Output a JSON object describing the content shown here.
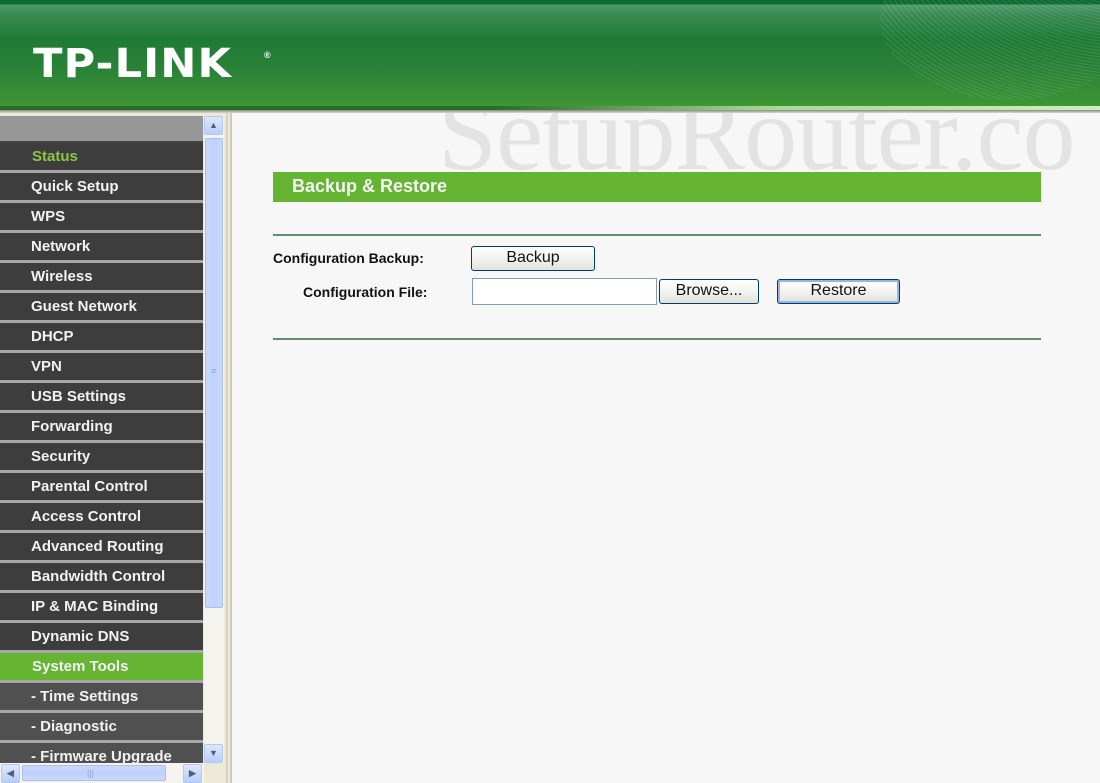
{
  "header": {
    "logo": "TP-LINK",
    "logo_mark": "®",
    "colors": {
      "header_green": "#1f7a37",
      "accent_green": "#66b532",
      "menu_dark": "#3d3d3d",
      "status_green": "#8dc63f"
    }
  },
  "watermark": "SetupRouter.co",
  "sidebar": {
    "items": [
      {
        "label": "Status",
        "state": "highlight"
      },
      {
        "label": "Quick Setup"
      },
      {
        "label": "WPS"
      },
      {
        "label": "Network"
      },
      {
        "label": "Wireless"
      },
      {
        "label": "Guest Network"
      },
      {
        "label": "DHCP"
      },
      {
        "label": "VPN"
      },
      {
        "label": "USB Settings"
      },
      {
        "label": "Forwarding"
      },
      {
        "label": "Security"
      },
      {
        "label": "Parental Control"
      },
      {
        "label": "Access Control"
      },
      {
        "label": "Advanced Routing"
      },
      {
        "label": "Bandwidth Control"
      },
      {
        "label": "IP & MAC Binding"
      },
      {
        "label": "Dynamic DNS"
      },
      {
        "label": "System Tools",
        "state": "active"
      },
      {
        "label": "- Time Settings",
        "state": "sub"
      },
      {
        "label": "- Diagnostic",
        "state": "sub"
      },
      {
        "label": "- Firmware Upgrade",
        "state": "sub"
      }
    ],
    "scroll": {
      "up_icon": "▲",
      "down_icon": "▼",
      "left_icon": "◀",
      "right_icon": "▶"
    }
  },
  "main": {
    "title": "Backup & Restore",
    "config_backup_label": "Configuration Backup:",
    "backup_button": "Backup",
    "config_file_label": "Configuration File:",
    "config_file_value": "",
    "browse_button": "Browse...",
    "restore_button": "Restore"
  }
}
